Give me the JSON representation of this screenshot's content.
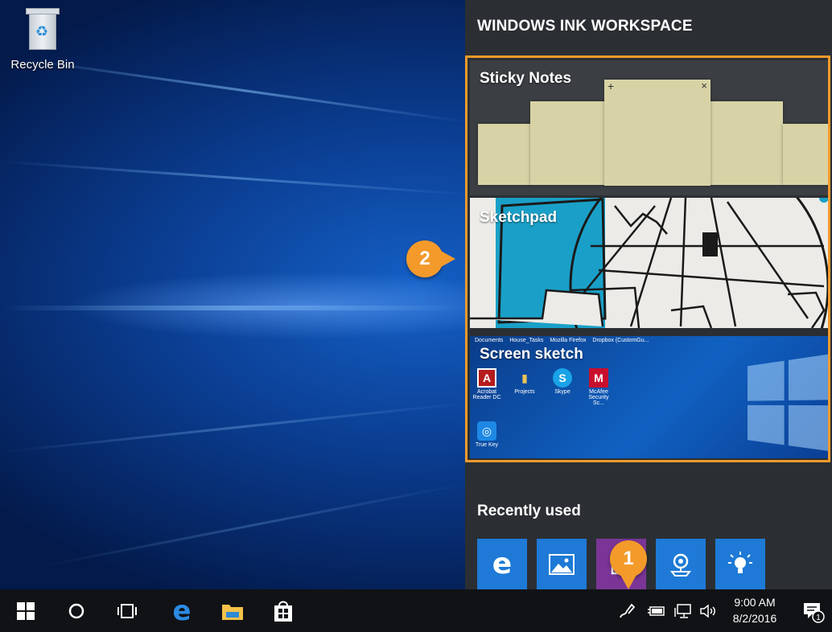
{
  "desktop": {
    "recycle_bin_label": "Recycle Bin"
  },
  "ink_workspace": {
    "title": "WINDOWS INK WORKSPACE",
    "tiles": {
      "sticky_notes": "Sticky Notes",
      "sketchpad": "Sketchpad",
      "screen_sketch": "Screen sketch"
    },
    "sticky_note_controls": {
      "add": "+",
      "close": "×"
    },
    "screen_sketch_preview": {
      "top_labels": [
        "Documents",
        "House_Tasks",
        "Mozilla Firefox",
        "Dropbox (CustomGu..."
      ],
      "icons": [
        {
          "label": "Acrobat Reader DC",
          "icon": "acrobat-icon",
          "glyph": "A",
          "color": "#b51c1c"
        },
        {
          "label": "Projects",
          "icon": "folder-icon",
          "glyph": "▮",
          "color": "#e9c45a"
        },
        {
          "label": "Skype",
          "icon": "skype-icon",
          "glyph": "S",
          "color": "#1aa3e8"
        },
        {
          "label": "McAfee Security Sc...",
          "icon": "mcafee-icon",
          "glyph": "M",
          "color": "#c8102e"
        },
        {
          "label": "True Key",
          "icon": "true-key-icon",
          "glyph": "◎",
          "color": "#1e88e5"
        }
      ]
    },
    "recently_used_title": "Recently used",
    "recently_used": [
      {
        "name": "edge",
        "icon": "edge-icon",
        "color": "#1e7ad6"
      },
      {
        "name": "photos",
        "icon": "photos-icon",
        "color": "#1e7ad6"
      },
      {
        "name": "onenote",
        "icon": "onenote-icon",
        "color": "#7b3596"
      },
      {
        "name": "maps",
        "icon": "maps-icon",
        "color": "#1e7ad6"
      },
      {
        "name": "tips",
        "icon": "tips-icon",
        "color": "#1e7ad6"
      }
    ]
  },
  "callouts": {
    "first": "1",
    "second": "2"
  },
  "taskbar": {
    "time": "9:00 AM",
    "date": "8/2/2016",
    "notification_count": "1"
  },
  "colors": {
    "accent": "#f39a2b",
    "panel_bg": "#2b2f33",
    "taskbar_bg": "#101215",
    "tile_blue": "#1e7ad6",
    "sticky_note": "#d8d3a6",
    "sketch_cyan": "#1aa0c8"
  }
}
